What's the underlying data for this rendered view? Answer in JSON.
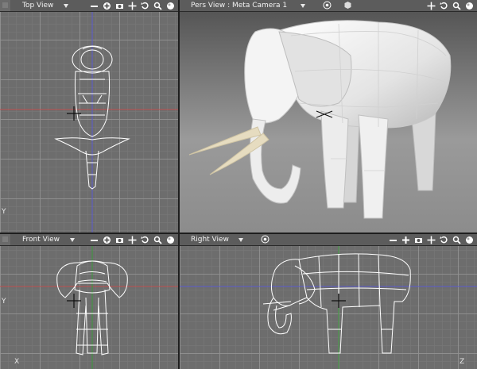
{
  "viewports": {
    "top": {
      "title": "Top View"
    },
    "pers": {
      "title": "Pers View : Meta Camera 1"
    },
    "front": {
      "title": "Front View"
    },
    "right": {
      "title": "Right View"
    }
  },
  "axis_labels": {
    "top_y": "Y",
    "front_y": "Y",
    "front_x": "X",
    "right_z": "Z"
  },
  "icons": [
    "zoom-out-icon",
    "zoom-in-icon",
    "camera-icon",
    "pan-icon",
    "rotate-icon",
    "magnify-icon",
    "reset-view-icon",
    "target-icon",
    "cube-icon",
    "viewport-menu-icon"
  ],
  "colors": {
    "x_axis": "#c05050",
    "y_axis": "#5a5ad0",
    "z_axis": "#3a9a3a",
    "wire": "#ffffff",
    "tusk": "#e6dcc0"
  }
}
